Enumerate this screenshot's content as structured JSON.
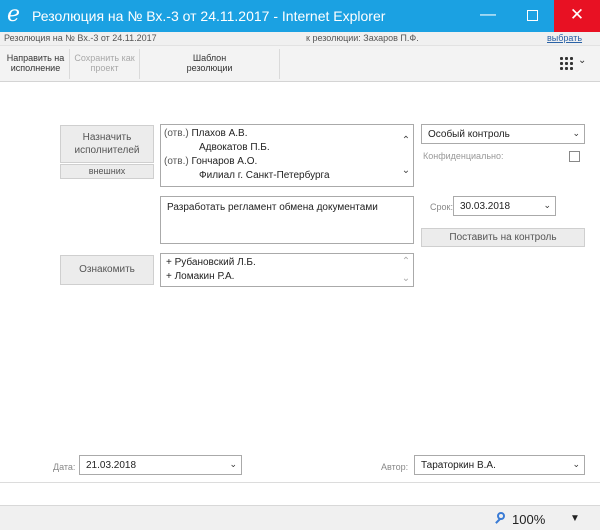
{
  "window": {
    "title": "Резолюция на № Вх.-3 от 24.11.2017 - Internet Explorer",
    "minimize_glyph": "—",
    "close_glyph": "✕",
    "logo_glyph": "e"
  },
  "infoline": {
    "document": "Резолюция на № Вх.-3 от 24.11.2017",
    "to_resolution": "к резолюции: Захаров П.Ф.",
    "choose_link": "выбрать"
  },
  "toolbar": {
    "send_line1": "Направить на",
    "send_line2": "исполнение",
    "save_line1": "Сохранить как",
    "save_line2": "проект",
    "template_line1": "Шаблон",
    "template_line2": "резолюции",
    "menu_icon": "grid-icon"
  },
  "executors": {
    "assign_line1": "Назначить",
    "assign_line2": "исполнителей",
    "external_label": "внешних",
    "items": [
      {
        "tag": "(отв.)",
        "name": "Плахов А.В."
      },
      {
        "tag": "",
        "name": "Адвокатов П.Б."
      },
      {
        "tag": "(отв.)",
        "name": "Гончаров А.О."
      },
      {
        "tag": "",
        "name": "Филиал г. Санкт-Петербурга"
      }
    ]
  },
  "control": {
    "selected": "Особый контроль",
    "confidential_label": "Конфиденциально:",
    "confidential_checked": false
  },
  "task": {
    "text": "Разработать регламент обмена документами"
  },
  "due": {
    "label": "Срок:",
    "value": "30.03.2018",
    "put_control_label": "Поставить на контроль"
  },
  "familiarize": {
    "button_label": "Ознакомить",
    "items": [
      "+ Рубановский Л.Б.",
      "+ Ломакин Р.А."
    ]
  },
  "footer": {
    "date_label": "Дата:",
    "date_value": "21.03.2018",
    "author_label": "Автор:",
    "author_value": "Тараторкин В.А."
  },
  "statusbar": {
    "zoom": "100%"
  },
  "colors": {
    "titlebar": "#1ba1e2",
    "close_button": "#e81123",
    "link": "#2a62a6"
  }
}
